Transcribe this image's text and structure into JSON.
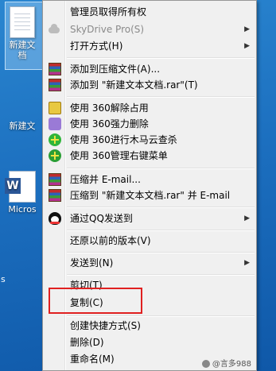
{
  "desktop": {
    "icons": [
      {
        "label": "新建文本文档",
        "short": "新建文\n档"
      },
      {
        "label": "新建文"
      },
      {
        "label": "Micros"
      }
    ],
    "left_edge_text": "s"
  },
  "menu": {
    "items": [
      {
        "label": "管理员取得所有权",
        "icon": ""
      },
      {
        "label": "SkyDrive Pro(S)",
        "icon": "cloud-icon",
        "disabled": true,
        "submenu": true
      },
      {
        "label": "打开方式(H)",
        "submenu": true
      },
      {
        "label": "添加到压缩文件(A)...",
        "icon": "winrar-icon"
      },
      {
        "label": "添加到 \"新建文本文档.rar\"(T)",
        "icon": "winrar-icon"
      },
      {
        "label": "使用 360解除占用",
        "icon": "360-unlock-icon"
      },
      {
        "label": "使用 360强力删除",
        "icon": "360-shred-icon"
      },
      {
        "label": "使用 360进行木马云查杀",
        "icon": "360-scan-icon"
      },
      {
        "label": "使用 360管理右键菜单",
        "icon": "360-menu-icon"
      },
      {
        "label": "压缩并 E-mail...",
        "icon": "winrar-icon"
      },
      {
        "label": "压缩到 \"新建文本文档.rar\" 并 E-mail",
        "icon": "winrar-icon"
      },
      {
        "label": "通过QQ发送到",
        "icon": "qq-icon",
        "submenu": true
      },
      {
        "label": "还原以前的版本(V)"
      },
      {
        "label": "发送到(N)",
        "submenu": true
      },
      {
        "label": "剪切(T)"
      },
      {
        "label": "复制(C)"
      },
      {
        "label": "创建快捷方式(S)"
      },
      {
        "label": "删除(D)"
      },
      {
        "label": "重命名(M)"
      }
    ],
    "arrow_glyph": "▶"
  },
  "watermark": {
    "text": "@言多988"
  },
  "colors": {
    "highlight": "#e02020",
    "menu_bg": "#f0f0f0"
  }
}
